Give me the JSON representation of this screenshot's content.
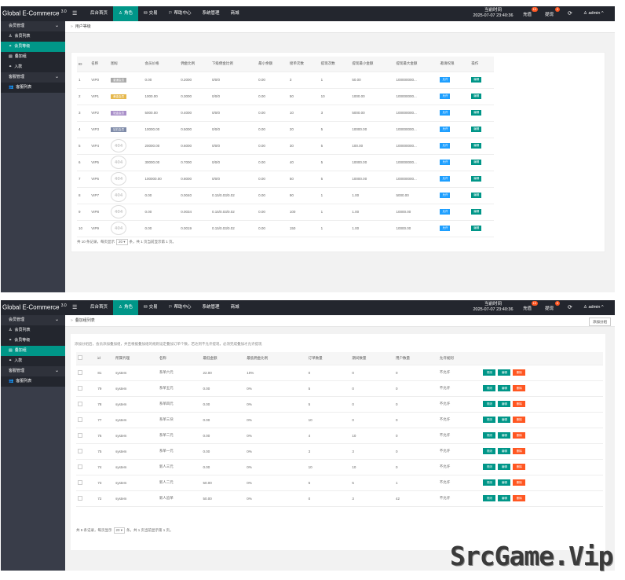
{
  "brand": {
    "name": "Global E-Commerce",
    "version": "3.0"
  },
  "nav": {
    "items": [
      {
        "label": "后台首页",
        "icon": "",
        "active": false
      },
      {
        "label": "角色",
        "icon": "♙",
        "active": true
      },
      {
        "label": "交易",
        "icon": "⛁",
        "active": false
      },
      {
        "label": "帮助中心",
        "icon": "⚐",
        "active": false
      },
      {
        "label": "系统管理",
        "icon": "",
        "active": false
      },
      {
        "label": "商城",
        "icon": "",
        "active": false
      }
    ],
    "clock_label": "当前时间",
    "clock_value": "2025-07-07 23:40:36",
    "recharge_label": "充值",
    "recharge_count": "10",
    "withdraw_label": "提现",
    "withdraw_count": "0",
    "admin_label": "admin"
  },
  "sidebar": {
    "items": [
      {
        "label": "会员管理",
        "type": "group",
        "arrow": "v"
      },
      {
        "label": "会员列表",
        "type": "sub",
        "icon": "♙"
      },
      {
        "label": "会员等级",
        "type": "sub",
        "icon": "⚭"
      },
      {
        "label": "叠加组",
        "type": "sub",
        "icon": "▤"
      },
      {
        "label": "入款",
        "type": "sub",
        "icon": "⚭"
      },
      {
        "label": "客服管理",
        "type": "group",
        "arrow": "v"
      },
      {
        "label": "客服列表",
        "type": "sub",
        "icon": "👥"
      }
    ]
  },
  "panel1": {
    "breadcrumb": "用户等级",
    "columns": [
      "ID",
      "名称",
      "图标",
      "会员价格",
      "佣金比例",
      "下级佣金比例",
      "最小余额",
      "接单次数",
      "提现次数",
      "提现最小金额",
      "提现最大金额",
      "邀请权限",
      "操作"
    ],
    "rows": [
      {
        "id": "1",
        "name": "VIP0",
        "icon_text": "普通会员",
        "icon_color": "#aaaaaa",
        "price": "0.00",
        "rate": "0.2000",
        "sub_rate": "0/0/0",
        "min_bal": "0.00",
        "orders": "3",
        "wd_times": "1",
        "wd_min": "50.00",
        "wd_max": "100000000...",
        "invite": "允许",
        "op": "编辑"
      },
      {
        "id": "2",
        "name": "VIP1",
        "icon_text": "黄金会员",
        "icon_color": "#e6b84d",
        "price": "1000.00",
        "rate": "0.3000",
        "sub_rate": "0/0/0",
        "min_bal": "0.00",
        "orders": "50",
        "wd_times": "10",
        "wd_min": "1000.00",
        "wd_max": "100000000...",
        "invite": "允许",
        "op": "编辑"
      },
      {
        "id": "3",
        "name": "VIP2",
        "icon_text": "铂金会员",
        "icon_color": "#a98fc9",
        "price": "5000.00",
        "rate": "0.4000",
        "sub_rate": "0/0/0",
        "min_bal": "0.00",
        "orders": "10",
        "wd_times": "3",
        "wd_min": "5000.00",
        "wd_max": "100000000...",
        "invite": "允许",
        "op": "编辑"
      },
      {
        "id": "4",
        "name": "VIP3",
        "icon_text": "钻石会员",
        "icon_color": "#7e8aa8",
        "price": "10000.00",
        "rate": "0.5000",
        "sub_rate": "0/0/0",
        "min_bal": "0.00",
        "orders": "20",
        "wd_times": "5",
        "wd_min": "10000.00",
        "wd_max": "100000000...",
        "invite": "允许",
        "op": "编辑"
      },
      {
        "id": "5",
        "name": "VIP4",
        "icon_text": "404",
        "icon_color": "",
        "price": "20000.00",
        "rate": "0.6000",
        "sub_rate": "0/0/0",
        "min_bal": "0.00",
        "orders": "30",
        "wd_times": "5",
        "wd_min": "100.00",
        "wd_max": "100000000...",
        "invite": "允许",
        "op": "编辑"
      },
      {
        "id": "6",
        "name": "VIP5",
        "icon_text": "404",
        "icon_color": "",
        "price": "30000.00",
        "rate": "0.7000",
        "sub_rate": "0/0/0",
        "min_bal": "0.00",
        "orders": "40",
        "wd_times": "5",
        "wd_min": "10000.00",
        "wd_max": "100000000...",
        "invite": "允许",
        "op": "编辑"
      },
      {
        "id": "7",
        "name": "VIP6",
        "icon_text": "404",
        "icon_color": "",
        "price": "100000.00",
        "rate": "0.8000",
        "sub_rate": "0/0/0",
        "min_bal": "0.00",
        "orders": "50",
        "wd_times": "5",
        "wd_min": "10000.00",
        "wd_max": "100000000...",
        "invite": "允许",
        "op": "编辑"
      },
      {
        "id": "8",
        "name": "VIP7",
        "icon_text": "404",
        "icon_color": "",
        "price": "0.00",
        "rate": "0.0040",
        "sub_rate": "0.15/0.03/0.02",
        "min_bal": "0.00",
        "orders": "90",
        "wd_times": "1",
        "wd_min": "1.00",
        "wd_max": "5000.00",
        "invite": "允许",
        "op": "编辑"
      },
      {
        "id": "9",
        "name": "VIP8",
        "icon_text": "404",
        "icon_color": "",
        "price": "0.00",
        "rate": "0.0034",
        "sub_rate": "0.15/0.03/0.02",
        "min_bal": "0.00",
        "orders": "100",
        "wd_times": "1",
        "wd_min": "1.00",
        "wd_max": "10000.00",
        "invite": "允许",
        "op": "编辑"
      },
      {
        "id": "10",
        "name": "VIP9",
        "icon_text": "404",
        "icon_color": "",
        "price": "0.00",
        "rate": "0.0019",
        "sub_rate": "0.15/0.03/0.02",
        "min_bal": "0.00",
        "orders": "150",
        "wd_times": "1",
        "wd_min": "1.00",
        "wd_max": "10000.00",
        "invite": "允许",
        "op": "编辑"
      }
    ],
    "pager_prefix": "共 10 条记录，每页显示",
    "pager_size": "20",
    "pager_suffix": "条，共 1 页当前显示第 1 页。"
  },
  "panel2": {
    "breadcrumb": "叠加组列表",
    "add_button": "添加分组",
    "tip": "添加分组后，会员添加叠加组，并且根据叠加组的规则设定叠加订单个数，若达到不允许提现，必须完成叠加才允许提现",
    "columns": [
      "",
      "id",
      "所属代理",
      "名称",
      "最低金额",
      "最低佣金比例",
      "订单数量",
      "期间数量",
      "用户数量",
      "允许规则",
      ""
    ],
    "rows": [
      {
        "id": "81",
        "agent": "system",
        "name": "系单六元",
        "min_amount": "22.00",
        "min_rate": "10%",
        "orders": "0",
        "period": "0",
        "users": "0",
        "rule": "不允许"
      },
      {
        "id": "79",
        "agent": "system",
        "name": "系单五元",
        "min_amount": "0.00",
        "min_rate": "0%",
        "orders": "5",
        "period": "0",
        "users": "0",
        "rule": "不允许"
      },
      {
        "id": "78",
        "agent": "system",
        "name": "系单四元",
        "min_amount": "0.00",
        "min_rate": "0%",
        "orders": "5",
        "period": "0",
        "users": "0",
        "rule": "不允许"
      },
      {
        "id": "77",
        "agent": "system",
        "name": "系单三块",
        "min_amount": "0.00",
        "min_rate": "0%",
        "orders": "10",
        "period": "0",
        "users": "0",
        "rule": "不允许"
      },
      {
        "id": "76",
        "agent": "system",
        "name": "系单二元",
        "min_amount": "0.00",
        "min_rate": "0%",
        "orders": "4",
        "period": "10",
        "users": "0",
        "rule": "不允许"
      },
      {
        "id": "75",
        "agent": "system",
        "name": "系单一元",
        "min_amount": "0.00",
        "min_rate": "0%",
        "orders": "3",
        "period": "3",
        "users": "0",
        "rule": "不允许"
      },
      {
        "id": "74",
        "agent": "system",
        "name": "新人三元",
        "min_amount": "0.00",
        "min_rate": "0%",
        "orders": "10",
        "period": "10",
        "users": "0",
        "rule": "不允许"
      },
      {
        "id": "73",
        "agent": "system",
        "name": "新人二元",
        "min_amount": "50.00",
        "min_rate": "0%",
        "orders": "5",
        "period": "5",
        "users": "1",
        "rule": "不允许"
      },
      {
        "id": "72",
        "agent": "system",
        "name": "新人追单",
        "min_amount": "50.00",
        "min_rate": "0%",
        "orders": "0",
        "period": "3",
        "users": "42",
        "rule": "不允许"
      }
    ],
    "op_view": "规则",
    "op_edit": "编辑",
    "op_del": "删除",
    "pager_prefix": "共 9 条记录，每页显示",
    "pager_size": "20",
    "pager_suffix": "条，共 1 页当前显示第 1 页。"
  },
  "watermark": "SrcGame.Vip"
}
